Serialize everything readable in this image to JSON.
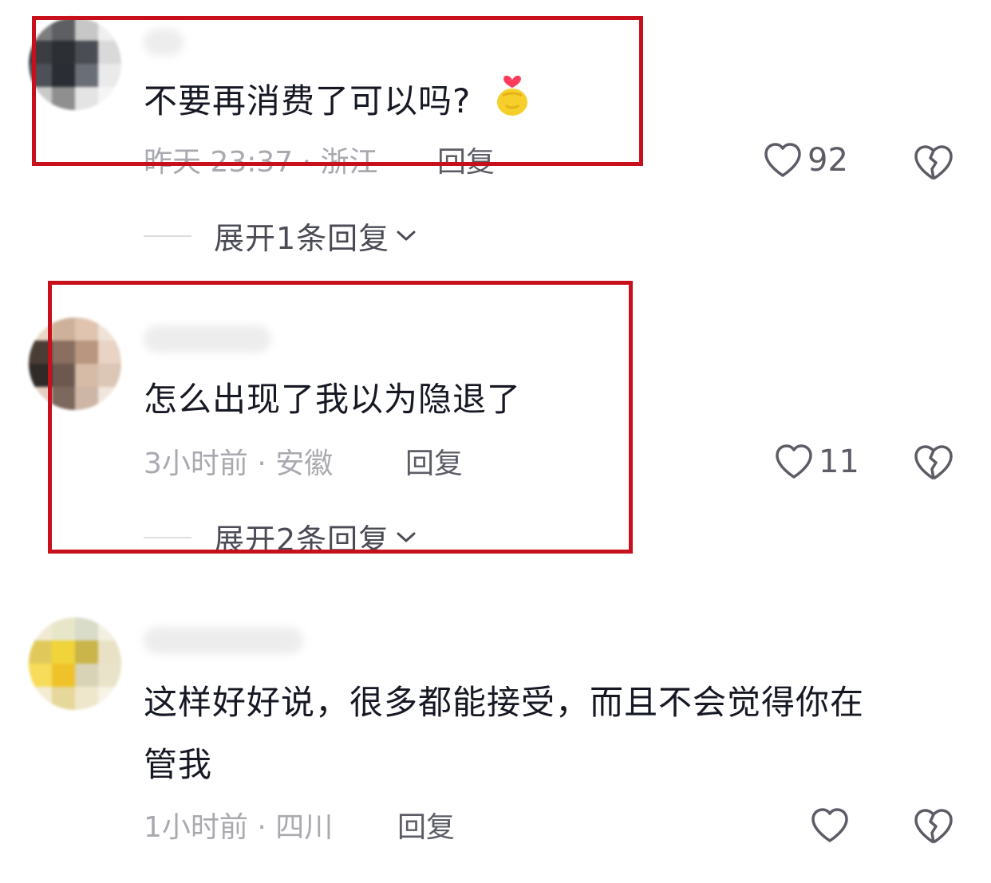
{
  "comments": [
    {
      "text": "不要再消费了可以吗?",
      "time_location": "昨天 23:37 · 浙江",
      "reply_label": "回复",
      "likes": "92",
      "expand_label": "展开1条回复",
      "emoji": "heart-hand-emoji",
      "avatar_colors": [
        "#7d7d7f",
        "#5e5f62",
        "#c7c7c7",
        "#efefef",
        "#3b3d42",
        "#2c2f34",
        "#4a4d53",
        "#d9d9d9",
        "#4c5058",
        "#2a2d33",
        "#6a6e76",
        "#eaeaea",
        "#c9c9c9",
        "#8f8f90",
        "#e4e4e4",
        "#f5f5f5"
      ]
    },
    {
      "text": "怎么出现了我以为隐退了",
      "time_location": "3小时前 · 安徽",
      "reply_label": "回复",
      "likes": "11",
      "expand_label": "展开2条回复",
      "avatar_colors": [
        "#e9d6c6",
        "#ceb19a",
        "#e0c4b0",
        "#efe2d7",
        "#4a3d36",
        "#8a6e60",
        "#b89680",
        "#e8d3c4",
        "#2f2a28",
        "#6c584e",
        "#d6bba6",
        "#dcc6b6",
        "#e4d0c2",
        "#7d685d",
        "#cdb6a6",
        "#f1e6dd"
      ]
    },
    {
      "text_line1": "这样好好说，很多都能接受，而且不会觉得你在",
      "text_line2": "管我",
      "time_location": "1小时前 · 四川",
      "reply_label": "回复",
      "likes": "",
      "avatar_colors": [
        "#f1ead3",
        "#e8e6c9",
        "#d8dcc8",
        "#f3efe2",
        "#e0c95a",
        "#f0d43a",
        "#c9b54a",
        "#e9e1c5",
        "#f6dc5a",
        "#efc22a",
        "#d8d3b7",
        "#e8e3c9",
        "#f3ecd3",
        "#e6d79a",
        "#efe7cc",
        "#f7f3e6"
      ]
    }
  ],
  "colors": {
    "highlight": "#c8101c",
    "text": "#161823",
    "meta": "#a9aab0"
  },
  "icons": [
    "heart-outline-icon",
    "broken-heart-icon",
    "chevron-down-icon"
  ]
}
